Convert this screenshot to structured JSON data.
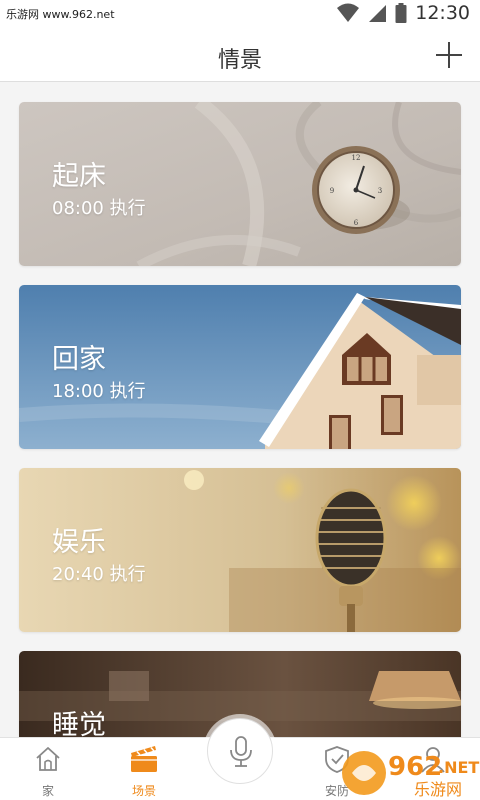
{
  "status_bar": {
    "watermark_text": "乐游网 www.962.net",
    "time": "12:30"
  },
  "header": {
    "title": "情景"
  },
  "scenes": [
    {
      "name": "起床",
      "time_text": "08:00 执行",
      "image": "alarm-clock-on-bed"
    },
    {
      "name": "回家",
      "time_text": "18:00 执行",
      "image": "house-under-blue-sky"
    },
    {
      "name": "娱乐",
      "time_text": "20:40 执行",
      "image": "vintage-microphone"
    },
    {
      "name": "睡觉",
      "time_text": "",
      "image": "bedroom-with-lamps"
    }
  ],
  "tabs": [
    {
      "label": "家",
      "icon": "home-icon",
      "active": false
    },
    {
      "label": "场景",
      "icon": "clapperboard-icon",
      "active": true
    },
    {
      "label": "安防",
      "icon": "shield-icon",
      "active": false
    },
    {
      "label": "",
      "icon": "user-icon",
      "active": false
    }
  ],
  "colors": {
    "accent": "#ef8a1b",
    "tab_inactive": "#777777",
    "header_text": "#333333"
  },
  "bottom_watermark": {
    "number": "962",
    "suffix": ".NET",
    "chinese": "乐游网"
  }
}
